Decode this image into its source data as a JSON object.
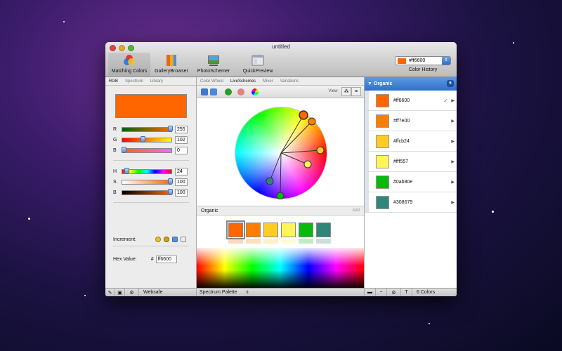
{
  "window": {
    "title": "untitled"
  },
  "toolbar": {
    "items": [
      {
        "label": "Matching Colors"
      },
      {
        "label": "GalleryBrowser"
      },
      {
        "label": "PhotoSchemer"
      },
      {
        "label": "QuickPreview"
      }
    ],
    "color_history": {
      "value": "#ff6600",
      "label": "Color History"
    }
  },
  "left_panel": {
    "tabs": [
      "RGB",
      "Spectrum",
      "Library"
    ],
    "current_color": "#ff6600",
    "rgb": [
      {
        "label": "R",
        "value": "255"
      },
      {
        "label": "G",
        "value": "102"
      },
      {
        "label": "B",
        "value": "0"
      }
    ],
    "hsb": [
      {
        "label": "H",
        "value": "24"
      },
      {
        "label": "S",
        "value": "100"
      },
      {
        "label": "B",
        "value": "100"
      }
    ],
    "increment_label": "Increment:",
    "hex_label": "Hex Value:",
    "hex_prefix": "#",
    "hex_value": "ff6600",
    "bottom_label": "Websafe"
  },
  "center_panel": {
    "tabs": [
      "Color Wheel",
      "LiveSchemes",
      "Mixer",
      "Variations"
    ],
    "view_label": "View:",
    "scheme_name": "Organic",
    "add_label": "Add",
    "palette_label": "Spectrum Palette",
    "swatches": [
      "#ff6600",
      "#ff7e00",
      "#ffcb24",
      "#fff557",
      "#0ab80e",
      "#308679"
    ]
  },
  "right_panel": {
    "header": "Organic",
    "count": "6",
    "items": [
      {
        "hex": "#ff6600",
        "label": "#ff6600",
        "check": "✓"
      },
      {
        "hex": "#ff7e00",
        "label": "#ff7e00",
        "check": ""
      },
      {
        "hex": "#ffcb24",
        "label": "#ffcb24",
        "check": ""
      },
      {
        "hex": "#fff557",
        "label": "#fff557",
        "check": ""
      },
      {
        "hex": "#0ab80e",
        "label": "#0ab80e",
        "check": ""
      },
      {
        "hex": "#308679",
        "label": "#308679",
        "check": ""
      }
    ],
    "footer_count": "6 Colors"
  }
}
